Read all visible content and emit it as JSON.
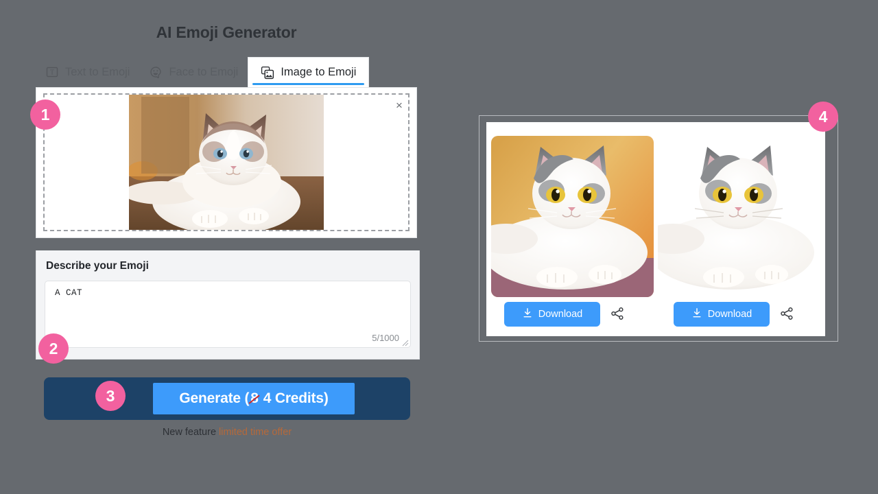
{
  "page": {
    "title": "AI Emoji Generator",
    "background_color": "#666a6f"
  },
  "tabs": [
    {
      "label": "Text to Emoji",
      "icon": "text-box-icon",
      "active": false
    },
    {
      "label": "Face to Emoji",
      "icon": "smiley-face-icon",
      "active": false
    },
    {
      "label": "Image to Emoji",
      "icon": "stacked-images-icon",
      "active": true
    }
  ],
  "upload": {
    "remove_label": "×",
    "image_alt": "uploaded-ragdoll-cat-photo"
  },
  "describe": {
    "label": "Describe your Emoji",
    "value": "A CAT",
    "placeholder": "Describe your emoji...",
    "counter": "5/1000"
  },
  "generate": {
    "prefix": "Generate (",
    "old_price": "8",
    "new_price": "4 Credits)",
    "promo_prefix": "New feature ",
    "promo_offer": "limited time offer",
    "accent_color": "#3d9bfb",
    "shell_color": "#1d4267",
    "strike_color": "#cf2b2b",
    "promo_color": "#b6693a"
  },
  "results": [
    {
      "id": "result-1",
      "background": "gradient-orange",
      "download_label": "Download",
      "share_label": "share-icon"
    },
    {
      "id": "result-2",
      "background": "transparent-white",
      "download_label": "Download",
      "share_label": "share-icon"
    }
  ],
  "steps": [
    {
      "number": "1",
      "target": "upload-panel"
    },
    {
      "number": "2",
      "target": "describe-panel"
    },
    {
      "number": "3",
      "target": "generate-button"
    },
    {
      "number": "4",
      "target": "results-panel"
    }
  ],
  "colors": {
    "badge_pink": "#f2619f",
    "tab_underline": "#2e9bf0"
  }
}
